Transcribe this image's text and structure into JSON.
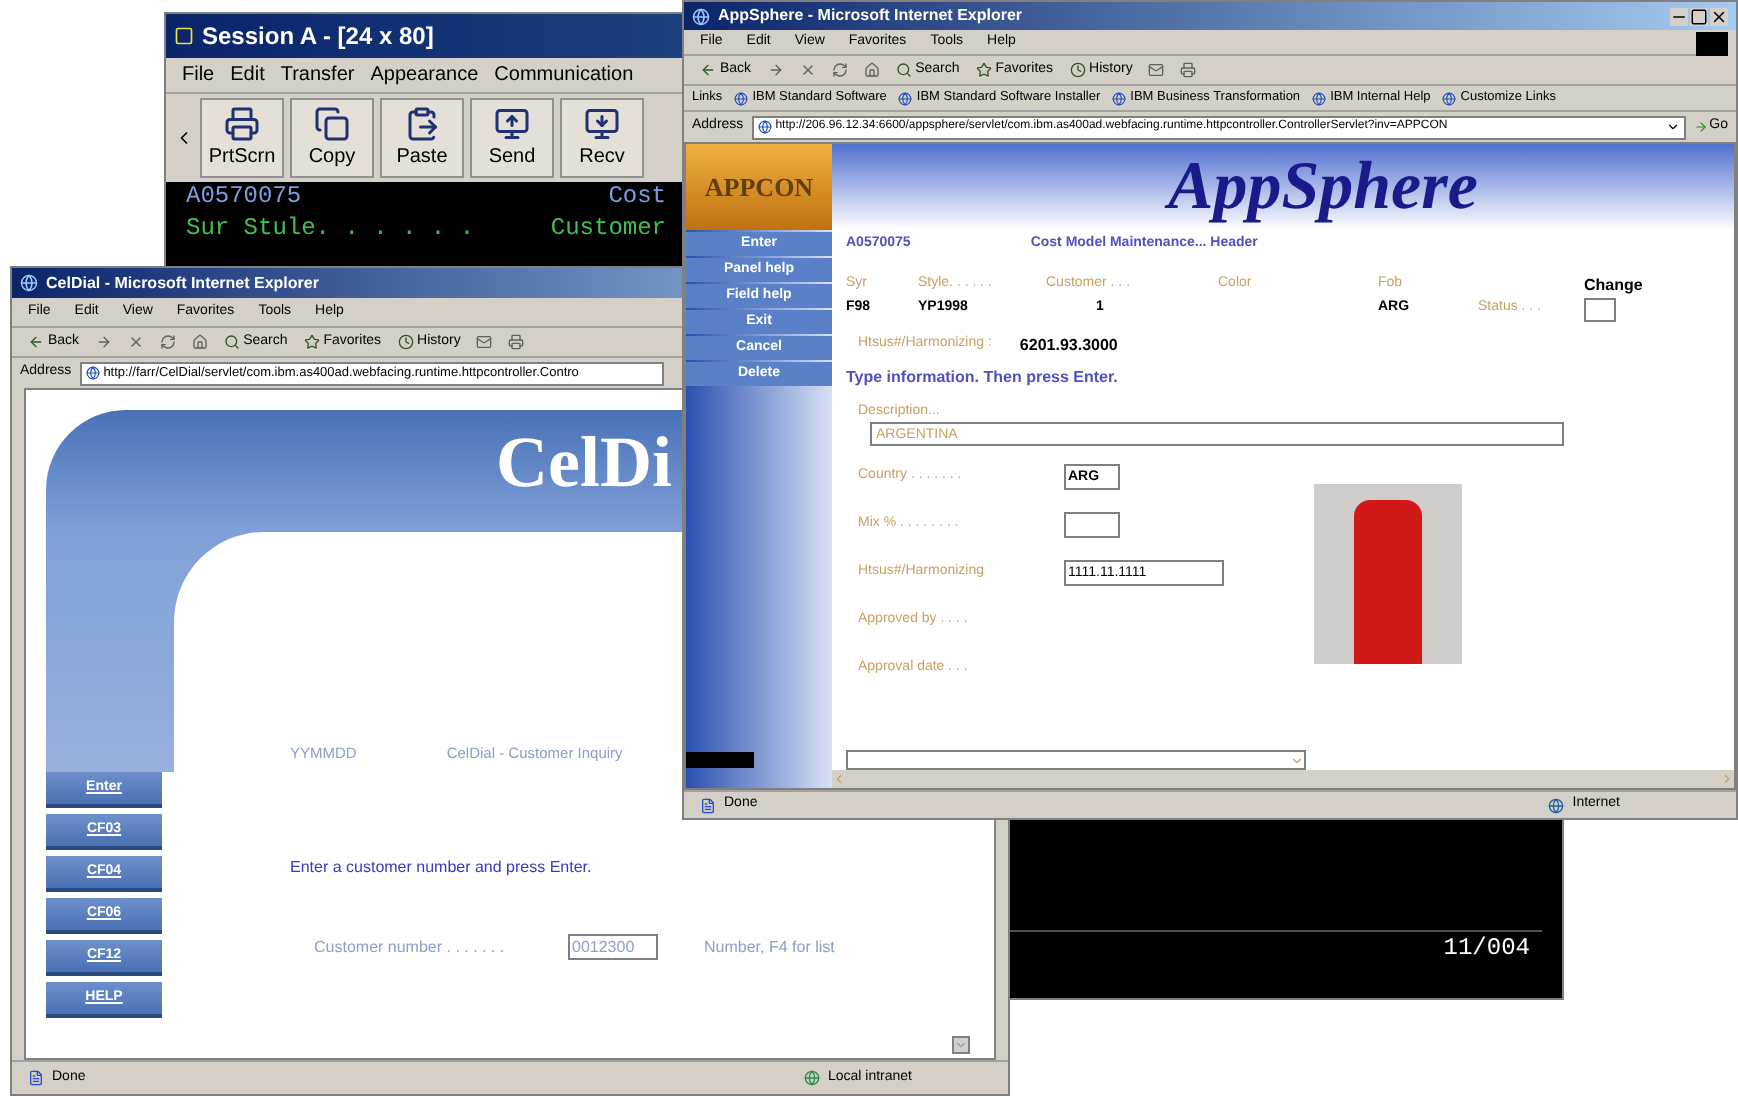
{
  "terminal_window": {
    "title": "Session A - [24 x 80]",
    "menu": [
      "File",
      "Edit",
      "Transfer",
      "Appearance",
      "Communication"
    ],
    "toolbar": [
      {
        "label": "PrtScrn",
        "kind": "print"
      },
      {
        "label": "Copy",
        "kind": "copy"
      },
      {
        "label": "Paste",
        "kind": "paste"
      },
      {
        "label": "Send",
        "kind": "send"
      },
      {
        "label": "Recv",
        "kind": "recv"
      }
    ],
    "screen_rows": [
      {
        "cells": [
          "A0570075",
          "Cost"
        ],
        "color": "#7f9ce0"
      },
      {
        "cells": [
          "Sur Stule. . . . . .",
          "Customer"
        ],
        "color": "#3fc04f"
      }
    ],
    "cursor_position": "11/004"
  },
  "celdial_window": {
    "title": "CelDial - Microsoft Internet Explorer",
    "menu": [
      "File",
      "Edit",
      "View",
      "Favorites",
      "Tools",
      "Help"
    ],
    "toolbar": [
      {
        "label": "Back",
        "kind": "back"
      },
      {
        "label": "Search",
        "kind": "search"
      },
      {
        "label": "Favorites",
        "kind": "favorites"
      },
      {
        "label": "History",
        "kind": "history"
      }
    ],
    "address_label": "Address",
    "address": "http://farr/CelDial/servlet/com.ibm.as400ad.webfacing.runtime.httpcontroller.Contro",
    "logo": "CelDi",
    "function_keys": [
      "Enter",
      "CF03",
      "CF04",
      "CF06",
      "CF12",
      "HELP"
    ],
    "date_label": "YYMMDD",
    "page_title": "CelDial - Customer Inquiry",
    "instruction": "Enter a customer number and press Enter.",
    "customer_field": {
      "label": "Customer number . . . . . . .",
      "value": "0012300",
      "hint": "Number, F4 for list"
    },
    "status": "Done",
    "zone": "Local intranet"
  },
  "appsphere_window": {
    "title": "AppSphere - Microsoft Internet Explorer",
    "menu": [
      "File",
      "Edit",
      "View",
      "Favorites",
      "Tools",
      "Help"
    ],
    "toolbar": [
      {
        "label": "Back",
        "kind": "back"
      },
      {
        "label": "Search",
        "kind": "search"
      },
      {
        "label": "Favorites",
        "kind": "favorites"
      },
      {
        "label": "History",
        "kind": "history"
      }
    ],
    "links_label": "Links",
    "links": [
      "IBM Standard Software",
      "IBM Standard Software Installer",
      "IBM Business Transformation",
      "IBM Internal Help",
      "Customize Links"
    ],
    "address_label": "Address",
    "address": "http://206.96.12.34:6600/appsphere/servlet/com.ibm.as400ad.webfacing.runtime.httpcontroller.ControllerServlet?inv=APPCON",
    "go": "Go",
    "logo": "APPCON",
    "banner": "AppSphere",
    "side_buttons": [
      "Enter",
      "Panel help",
      "Field help",
      "Exit",
      "Cancel",
      "Delete"
    ],
    "record_id": "A0570075",
    "screen_title": "Cost Model Maintenance... Header",
    "header_columns": [
      {
        "label": "Syr",
        "value": "F98"
      },
      {
        "label": "Style. . . . . .",
        "value": "YP1998"
      },
      {
        "label": "Customer . . .",
        "value": "1"
      },
      {
        "label": "Color"
      },
      {
        "label": "Fob",
        "value": "ARG"
      }
    ],
    "status_label": "Status . . .",
    "change_label": "Change",
    "harmonizing": {
      "label": "Htsus#/Harmonizing :",
      "value": "6201.93.3000"
    },
    "instruction": "Type information. Then press Enter.",
    "description": {
      "label": "Description...",
      "value": "ARGENTINA"
    },
    "fields": [
      {
        "label": "Country . . . . . . .",
        "value": "ARG",
        "kind": "short"
      },
      {
        "label": "Mix % . . . . . . . .",
        "kind": "short"
      },
      {
        "label": "Htsus#/Harmonizing",
        "value": "1111.11.1111",
        "kind": "wide"
      },
      {
        "label": "Approved by . . . .",
        "kind": "text"
      },
      {
        "label": "Approval date . . .",
        "kind": "text"
      }
    ],
    "status": "Done",
    "zone": "Internet"
  }
}
